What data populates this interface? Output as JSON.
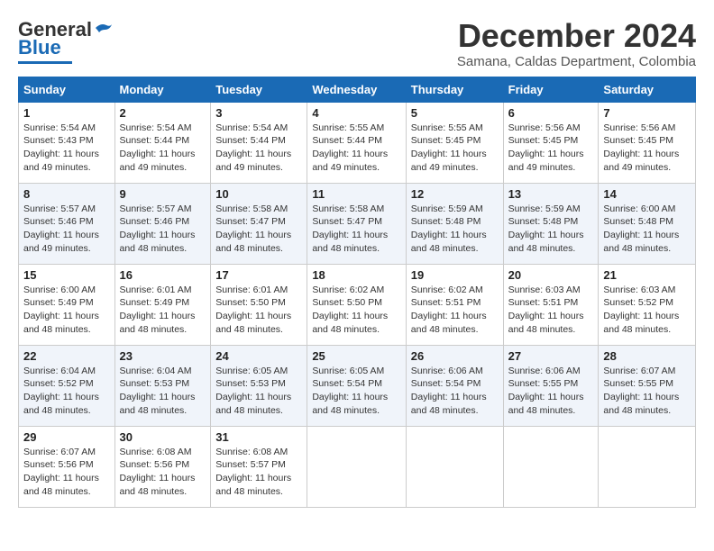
{
  "logo": {
    "part1": "General",
    "part2": "Blue"
  },
  "title": "December 2024",
  "subtitle": "Samana, Caldas Department, Colombia",
  "days_of_week": [
    "Sunday",
    "Monday",
    "Tuesday",
    "Wednesday",
    "Thursday",
    "Friday",
    "Saturday"
  ],
  "weeks": [
    [
      {
        "day": "1",
        "info": "Sunrise: 5:54 AM\nSunset: 5:43 PM\nDaylight: 11 hours\nand 49 minutes."
      },
      {
        "day": "2",
        "info": "Sunrise: 5:54 AM\nSunset: 5:44 PM\nDaylight: 11 hours\nand 49 minutes."
      },
      {
        "day": "3",
        "info": "Sunrise: 5:54 AM\nSunset: 5:44 PM\nDaylight: 11 hours\nand 49 minutes."
      },
      {
        "day": "4",
        "info": "Sunrise: 5:55 AM\nSunset: 5:44 PM\nDaylight: 11 hours\nand 49 minutes."
      },
      {
        "day": "5",
        "info": "Sunrise: 5:55 AM\nSunset: 5:45 PM\nDaylight: 11 hours\nand 49 minutes."
      },
      {
        "day": "6",
        "info": "Sunrise: 5:56 AM\nSunset: 5:45 PM\nDaylight: 11 hours\nand 49 minutes."
      },
      {
        "day": "7",
        "info": "Sunrise: 5:56 AM\nSunset: 5:45 PM\nDaylight: 11 hours\nand 49 minutes."
      }
    ],
    [
      {
        "day": "8",
        "info": "Sunrise: 5:57 AM\nSunset: 5:46 PM\nDaylight: 11 hours\nand 49 minutes."
      },
      {
        "day": "9",
        "info": "Sunrise: 5:57 AM\nSunset: 5:46 PM\nDaylight: 11 hours\nand 48 minutes."
      },
      {
        "day": "10",
        "info": "Sunrise: 5:58 AM\nSunset: 5:47 PM\nDaylight: 11 hours\nand 48 minutes."
      },
      {
        "day": "11",
        "info": "Sunrise: 5:58 AM\nSunset: 5:47 PM\nDaylight: 11 hours\nand 48 minutes."
      },
      {
        "day": "12",
        "info": "Sunrise: 5:59 AM\nSunset: 5:48 PM\nDaylight: 11 hours\nand 48 minutes."
      },
      {
        "day": "13",
        "info": "Sunrise: 5:59 AM\nSunset: 5:48 PM\nDaylight: 11 hours\nand 48 minutes."
      },
      {
        "day": "14",
        "info": "Sunrise: 6:00 AM\nSunset: 5:48 PM\nDaylight: 11 hours\nand 48 minutes."
      }
    ],
    [
      {
        "day": "15",
        "info": "Sunrise: 6:00 AM\nSunset: 5:49 PM\nDaylight: 11 hours\nand 48 minutes."
      },
      {
        "day": "16",
        "info": "Sunrise: 6:01 AM\nSunset: 5:49 PM\nDaylight: 11 hours\nand 48 minutes."
      },
      {
        "day": "17",
        "info": "Sunrise: 6:01 AM\nSunset: 5:50 PM\nDaylight: 11 hours\nand 48 minutes."
      },
      {
        "day": "18",
        "info": "Sunrise: 6:02 AM\nSunset: 5:50 PM\nDaylight: 11 hours\nand 48 minutes."
      },
      {
        "day": "19",
        "info": "Sunrise: 6:02 AM\nSunset: 5:51 PM\nDaylight: 11 hours\nand 48 minutes."
      },
      {
        "day": "20",
        "info": "Sunrise: 6:03 AM\nSunset: 5:51 PM\nDaylight: 11 hours\nand 48 minutes."
      },
      {
        "day": "21",
        "info": "Sunrise: 6:03 AM\nSunset: 5:52 PM\nDaylight: 11 hours\nand 48 minutes."
      }
    ],
    [
      {
        "day": "22",
        "info": "Sunrise: 6:04 AM\nSunset: 5:52 PM\nDaylight: 11 hours\nand 48 minutes."
      },
      {
        "day": "23",
        "info": "Sunrise: 6:04 AM\nSunset: 5:53 PM\nDaylight: 11 hours\nand 48 minutes."
      },
      {
        "day": "24",
        "info": "Sunrise: 6:05 AM\nSunset: 5:53 PM\nDaylight: 11 hours\nand 48 minutes."
      },
      {
        "day": "25",
        "info": "Sunrise: 6:05 AM\nSunset: 5:54 PM\nDaylight: 11 hours\nand 48 minutes."
      },
      {
        "day": "26",
        "info": "Sunrise: 6:06 AM\nSunset: 5:54 PM\nDaylight: 11 hours\nand 48 minutes."
      },
      {
        "day": "27",
        "info": "Sunrise: 6:06 AM\nSunset: 5:55 PM\nDaylight: 11 hours\nand 48 minutes."
      },
      {
        "day": "28",
        "info": "Sunrise: 6:07 AM\nSunset: 5:55 PM\nDaylight: 11 hours\nand 48 minutes."
      }
    ],
    [
      {
        "day": "29",
        "info": "Sunrise: 6:07 AM\nSunset: 5:56 PM\nDaylight: 11 hours\nand 48 minutes."
      },
      {
        "day": "30",
        "info": "Sunrise: 6:08 AM\nSunset: 5:56 PM\nDaylight: 11 hours\nand 48 minutes."
      },
      {
        "day": "31",
        "info": "Sunrise: 6:08 AM\nSunset: 5:57 PM\nDaylight: 11 hours\nand 48 minutes."
      },
      null,
      null,
      null,
      null
    ]
  ]
}
